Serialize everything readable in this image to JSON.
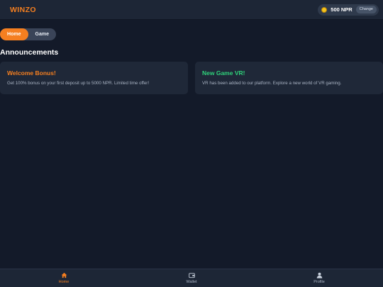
{
  "header": {
    "brand": "WINZO",
    "balance": "500 NPR",
    "change_label": "Change"
  },
  "tabs": [
    {
      "label": "Home",
      "active": true
    },
    {
      "label": "Game",
      "active": false
    }
  ],
  "announcements": {
    "title": "Announcements",
    "items": [
      {
        "title": "Welcome Bonus!",
        "body": "Get 100% bonus on your first deposit up to 5000 NPR. Limited time offer!",
        "color": "#f57f20"
      },
      {
        "title": "New Game VR!",
        "body": "VR has been added to our platform. Explore a new world of VR gaming.",
        "color": "#2fd17a"
      }
    ]
  },
  "bottom_nav": [
    {
      "label": "Home",
      "icon": "home-icon",
      "active": true
    },
    {
      "label": "Wallet",
      "icon": "wallet-icon",
      "active": false
    },
    {
      "label": "Profile",
      "icon": "user-icon",
      "active": false
    }
  ],
  "colors": {
    "accent": "#f57f20",
    "success": "#2fd17a",
    "background": "#131a29",
    "surface": "#1f2838"
  }
}
